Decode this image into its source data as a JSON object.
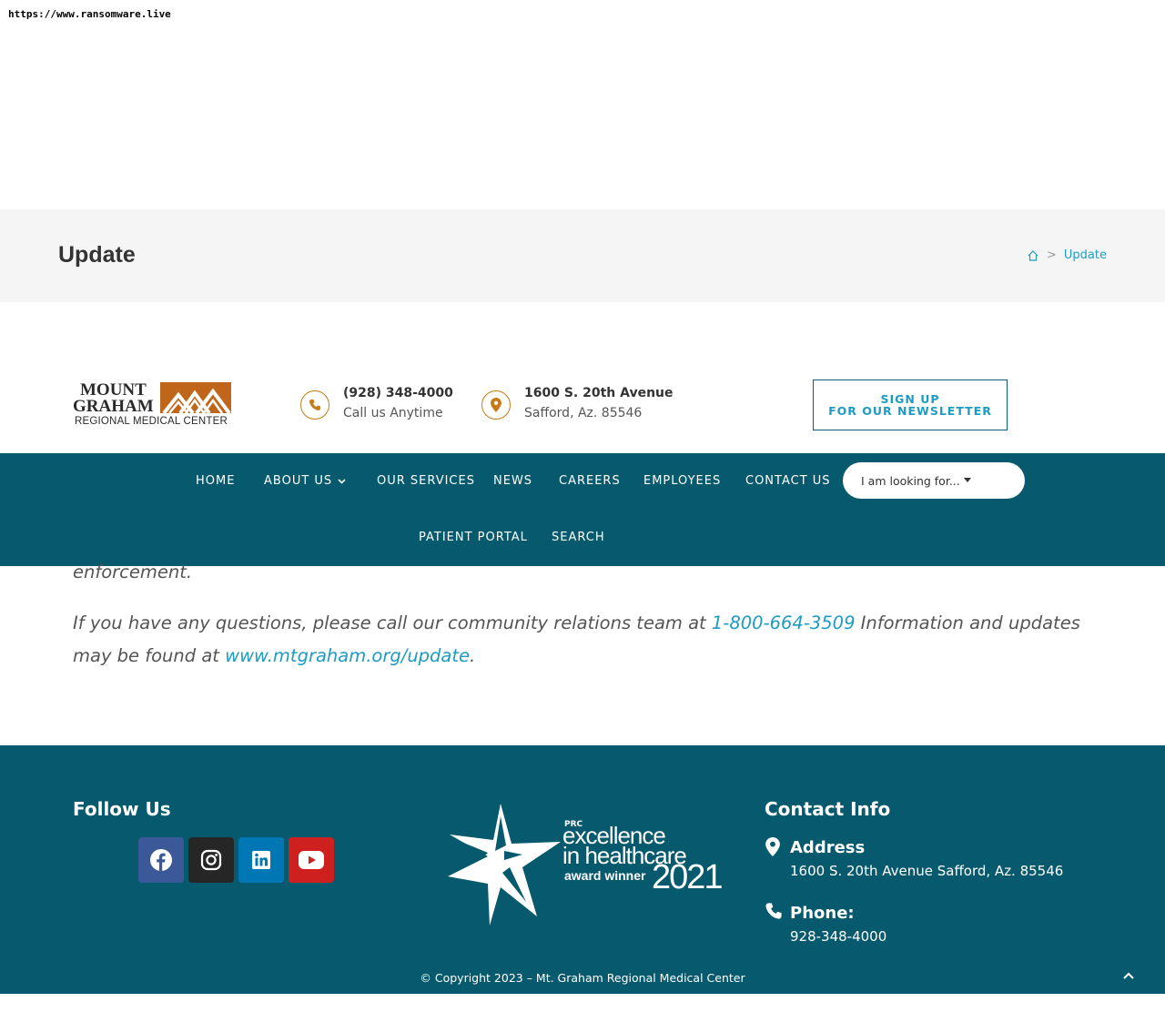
{
  "browser": {
    "url": "https://www.ransomware.live"
  },
  "page_header": {
    "title": "Update",
    "breadcrumb": {
      "home_icon": "home-icon",
      "separator": ">",
      "current": "Update"
    }
  },
  "topbar": {
    "logo": {
      "line1": "MOUNT",
      "line2": "GRAHAM",
      "line3": "REGIONAL MEDICAL CENTER"
    },
    "phone": {
      "icon": "phone-icon",
      "title": "(928) 348-4000",
      "subtitle": "Call us Anytime"
    },
    "address": {
      "icon": "map-marker-icon",
      "title": "1600 S. 20th Avenue",
      "subtitle": "Safford, Az. 85546"
    },
    "signup": {
      "line1": "SIGN UP",
      "line2": "FOR OUR NEWSLETTER"
    }
  },
  "nav": {
    "items": [
      "HOME",
      "ABOUT US",
      "OUR SERVICES",
      "NEWS",
      "CAREERS",
      "EMPLOYEES",
      "CONTACT US"
    ],
    "row2": [
      "PATIENT PORTAL",
      "SEARCH"
    ],
    "looking_for": "I am looking for..."
  },
  "content": {
    "p1_fragment": "enforcement.",
    "p2_prefix": "If you have any questions, please call our community relations team at ",
    "p2_phone": "1-800-664-3509",
    "p2_mid": " Information and updates may be found at ",
    "p2_link": "www.mtgraham.org/update",
    "p2_suffix": "."
  },
  "footer": {
    "follow_title": "Follow Us",
    "social": [
      {
        "icon": "facebook-icon",
        "color": "#3b5998"
      },
      {
        "icon": "instagram-icon",
        "color": "#262626"
      },
      {
        "icon": "linkedin-icon",
        "color": "#0077b5"
      },
      {
        "icon": "youtube-icon",
        "color": "#cd201f"
      }
    ],
    "award": {
      "l1": "PRC",
      "l2": "excellence",
      "l3": "in healthcare",
      "l4": "award winner",
      "year": "2021"
    },
    "contact_title": "Contact Info",
    "address_label": "Address",
    "address_value": "1600 S. 20th Avenue Safford, Az. 85546",
    "phone_label": "Phone:",
    "phone_value": "928-348-4000",
    "copyright": "© Copyright 2023 – Mt. Graham Regional Medical Center"
  },
  "colors": {
    "teal": "#075a6d",
    "accent": "#1e9bc4",
    "orange": "#c77a16"
  }
}
